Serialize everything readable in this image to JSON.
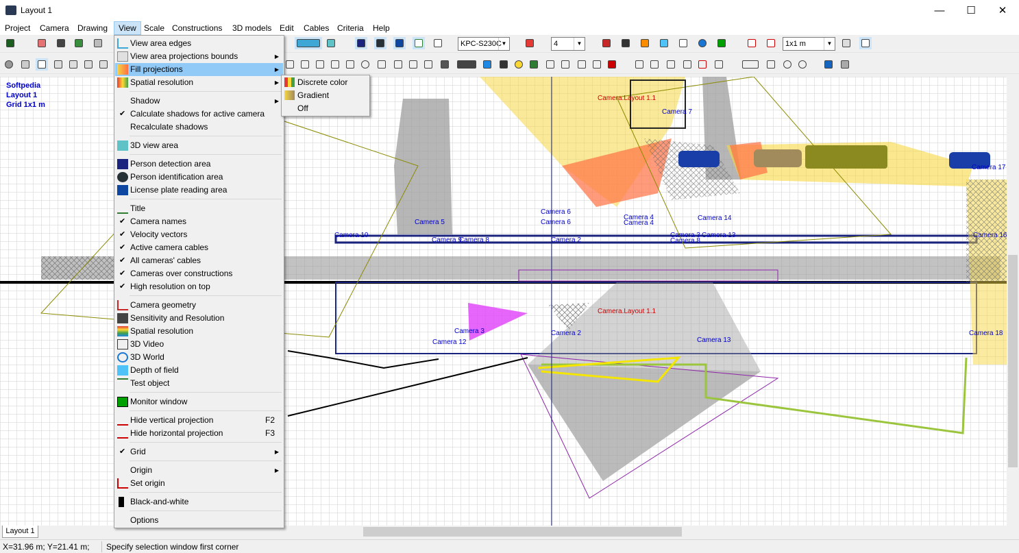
{
  "window": {
    "title": "Layout 1",
    "controls": {
      "minimize": "—",
      "maximize": "☐",
      "close": "✕"
    }
  },
  "menubar": [
    "Project",
    "Camera",
    "Drawing",
    "View",
    "Scale",
    "Constructions",
    "3D models",
    "Edit",
    "Cables",
    "Criteria",
    "Help"
  ],
  "toolbar": {
    "camera_model": "KPC-S230C",
    "count_value": "4",
    "grid_size": "1x1 m"
  },
  "canvas_info": {
    "line1": "Softpedia",
    "line2": "Layout 1",
    "line3": "Grid 1x1 m"
  },
  "camera_labels": [
    "Camera.Layout 1.1",
    "Camera 7",
    "Camera 5",
    "Camera 6",
    "Camera 6",
    "Camera 4",
    "Camera 4",
    "Camera 14",
    "Camera 10",
    "Camera 9",
    "Camera 8",
    "Camera 2",
    "Camera 3",
    "Camera 8",
    "Camera 13",
    "Camera 17",
    "Camera 16",
    "Camera.Layout 1.1",
    "Camera 3",
    "Camera 2",
    "Camera 12",
    "Camera 13",
    "Camera 18"
  ],
  "view_menu": [
    {
      "label": "View area edges",
      "icon": "view-area-edges-icon",
      "submenu": false
    },
    {
      "label": "View area projections bounds",
      "icon": "projection-bounds-icon",
      "submenu": true
    },
    {
      "label": "Fill projections",
      "icon": "fill-projections-icon",
      "submenu": true,
      "highlighted": true
    },
    {
      "label": "Spatial resolution",
      "icon": "spatial-resolution-icon",
      "submenu": true
    },
    {
      "label": "Shadow",
      "submenu": true
    },
    {
      "label": "Calculate shadows for active camera",
      "checked": true
    },
    {
      "label": "Recalculate shadows"
    },
    {
      "label": "3D view area",
      "icon": "3d-view-area-icon"
    },
    {
      "label": "Person detection area",
      "icon": "person-detection-icon"
    },
    {
      "label": "Person identification area",
      "icon": "person-identification-icon"
    },
    {
      "label": "License plate reading area",
      "icon": "license-plate-icon"
    },
    {
      "label": "Title",
      "icon": "title-icon"
    },
    {
      "label": "Camera names",
      "checked": true
    },
    {
      "label": "Velocity vectors",
      "checked": true
    },
    {
      "label": "Active camera cables",
      "checked": true
    },
    {
      "label": "All cameras' cables",
      "checked": true
    },
    {
      "label": "Cameras over constructions",
      "checked": true
    },
    {
      "label": "High resolution on top",
      "checked": true
    },
    {
      "label": "Camera geometry",
      "icon": "camera-geometry-icon"
    },
    {
      "label": "Sensitivity and Resolution",
      "icon": "sensitivity-icon"
    },
    {
      "label": "Spatial resolution",
      "icon": "spatial-resolution-bars-icon"
    },
    {
      "label": "3D Video",
      "icon": "3d-video-icon"
    },
    {
      "label": "3D World",
      "icon": "3d-world-icon"
    },
    {
      "label": "Depth of field",
      "icon": "depth-of-field-icon"
    },
    {
      "label": "Test object",
      "icon": "test-object-icon"
    },
    {
      "label": "Monitor window",
      "icon": "monitor-window-icon"
    },
    {
      "label": "Hide vertical projection",
      "icon": "hide-vertical-icon",
      "shortcut": "F2"
    },
    {
      "label": "Hide horizontal projection",
      "icon": "hide-horizontal-icon",
      "shortcut": "F3"
    },
    {
      "label": "Grid",
      "checked": true,
      "submenu": true
    },
    {
      "label": "Origin",
      "submenu": true
    },
    {
      "label": "Set origin",
      "icon": "set-origin-icon"
    },
    {
      "label": "Black-and-white",
      "icon": "black-white-icon"
    },
    {
      "label": "Options"
    }
  ],
  "fill_submenu": [
    {
      "label": "Discrete color",
      "icon": "discrete-color-icon"
    },
    {
      "label": "Gradient",
      "icon": "gradient-icon"
    },
    {
      "label": "Off"
    }
  ],
  "bottom": {
    "tab": "Layout 1",
    "coordinates": "X=31.96 m; Y=21.41 m;",
    "status": "Specify selection window first corner"
  },
  "colors": {
    "menu_highlight": "#91c9f7",
    "camera_label": "#0000cc",
    "active_camera": "#cc0000"
  }
}
